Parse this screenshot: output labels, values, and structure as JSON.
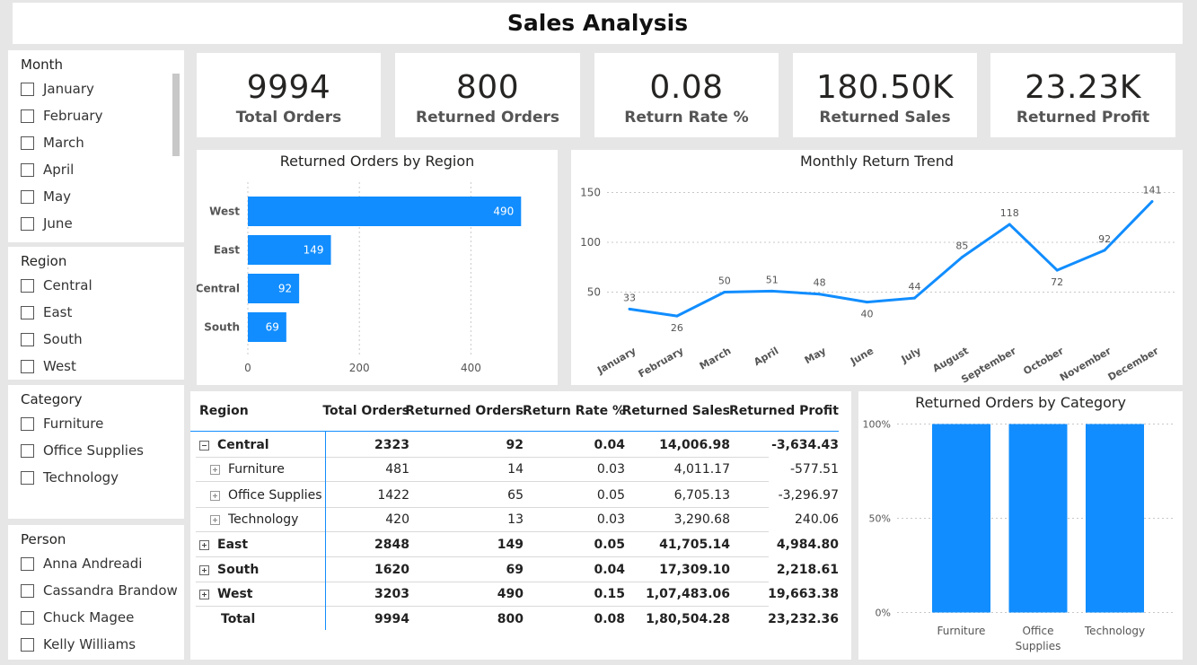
{
  "title": "Sales Analysis",
  "slicers": {
    "month": {
      "title": "Month",
      "items": [
        "January",
        "February",
        "March",
        "April",
        "May",
        "June"
      ]
    },
    "region": {
      "title": "Region",
      "items": [
        "Central",
        "East",
        "South",
        "West"
      ]
    },
    "category": {
      "title": "Category",
      "items": [
        "Furniture",
        "Office Supplies",
        "Technology"
      ]
    },
    "person": {
      "title": "Person",
      "items": [
        "Anna Andreadi",
        "Cassandra Brandow",
        "Chuck Magee",
        "Kelly Williams"
      ]
    }
  },
  "kpis": [
    {
      "value": "9994",
      "label": "Total Orders"
    },
    {
      "value": "800",
      "label": "Returned Orders"
    },
    {
      "value": "0.08",
      "label": "Return Rate %"
    },
    {
      "value": "180.50K",
      "label": "Returned Sales"
    },
    {
      "value": "23.23K",
      "label": "Returned Profit"
    }
  ],
  "accent_color": "#118DFF",
  "chart_data": [
    {
      "type": "bar",
      "orientation": "horizontal",
      "title": "Returned Orders by Region",
      "categories": [
        "West",
        "East",
        "Central",
        "South"
      ],
      "values": [
        490,
        149,
        92,
        69
      ],
      "xlim": [
        0,
        500
      ],
      "xticks": [
        0,
        200,
        400
      ],
      "data_labels": [
        "490",
        "149",
        "92",
        "69"
      ]
    },
    {
      "type": "line",
      "title": "Monthly Return Trend",
      "categories": [
        "January",
        "February",
        "March",
        "April",
        "May",
        "June",
        "July",
        "August",
        "September",
        "October",
        "November",
        "December"
      ],
      "values": [
        33,
        26,
        50,
        51,
        48,
        40,
        44,
        85,
        118,
        72,
        92,
        141
      ],
      "ylim": [
        0,
        150
      ],
      "yticks": [
        50,
        100,
        150
      ],
      "data_labels": [
        "33",
        "26",
        "50",
        "51",
        "48",
        "40",
        "44",
        "85",
        "118",
        "72",
        "92",
        "141"
      ],
      "grid": true
    },
    {
      "type": "bar",
      "title": "Returned Orders by Category",
      "categories": [
        "Furniture",
        "Office Supplies",
        "Technology"
      ],
      "category_lines": [
        [
          "Furniture"
        ],
        [
          "Office",
          "Supplies"
        ],
        [
          "Technology"
        ]
      ],
      "values": [
        1,
        1,
        1
      ],
      "ylim": [
        0,
        1
      ],
      "yticks": [
        "0%",
        "50%",
        "100%"
      ],
      "grid": true
    }
  ],
  "matrix": {
    "headers": [
      "Region",
      "Total Orders",
      "Returned Orders",
      "Return Rate %",
      "Returned Sales",
      "Returned Profit"
    ],
    "rows": [
      {
        "label": "Central",
        "level": 0,
        "expander": "minus",
        "values": [
          "2323",
          "92",
          "0.04",
          "14,006.98",
          "-3,634.43"
        ]
      },
      {
        "label": "Furniture",
        "level": 1,
        "expander": "plus",
        "values": [
          "481",
          "14",
          "0.03",
          "4,011.17",
          "-577.51"
        ]
      },
      {
        "label": "Office Supplies",
        "level": 1,
        "expander": "plus",
        "values": [
          "1422",
          "65",
          "0.05",
          "6,705.13",
          "-3,296.97"
        ]
      },
      {
        "label": "Technology",
        "level": 1,
        "expander": "plus",
        "values": [
          "420",
          "13",
          "0.03",
          "3,290.68",
          "240.06"
        ]
      },
      {
        "label": "East",
        "level": 0,
        "expander": "plus",
        "values": [
          "2848",
          "149",
          "0.05",
          "41,705.14",
          "4,984.80"
        ]
      },
      {
        "label": "South",
        "level": 0,
        "expander": "plus",
        "values": [
          "1620",
          "69",
          "0.04",
          "17,309.10",
          "2,218.61"
        ]
      },
      {
        "label": "West",
        "level": 0,
        "expander": "plus",
        "values": [
          "3203",
          "490",
          "0.15",
          "1,07,483.06",
          "19,663.38"
        ]
      },
      {
        "label": "Total",
        "level": 0,
        "expander": "none",
        "values": [
          "9994",
          "800",
          "0.08",
          "1,80,504.28",
          "23,232.36"
        ]
      }
    ]
  }
}
